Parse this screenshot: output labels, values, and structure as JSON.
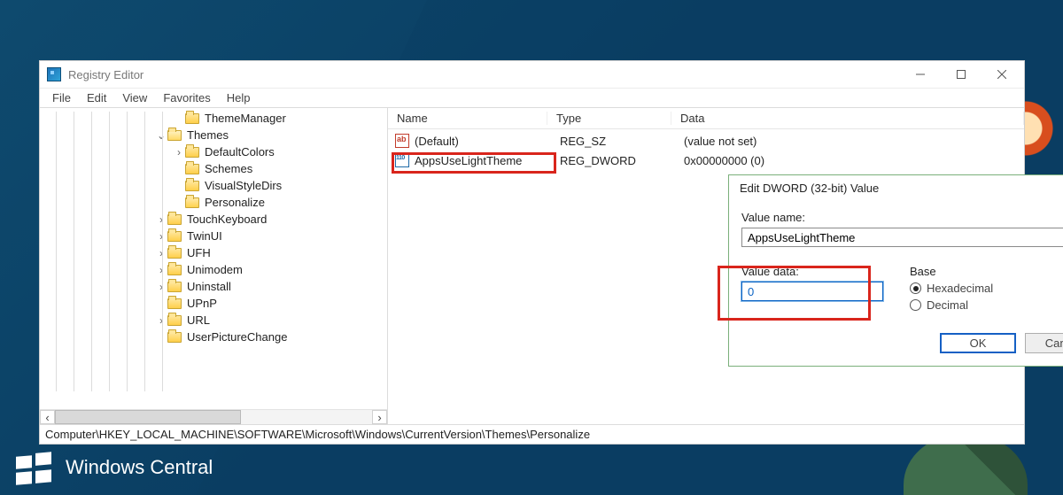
{
  "brand": {
    "name": "Windows Central"
  },
  "window": {
    "title": "Registry Editor",
    "menu": [
      "File",
      "Edit",
      "View",
      "Favorites",
      "Help"
    ],
    "status_path": "Computer\\HKEY_LOCAL_MACHINE\\SOFTWARE\\Microsoft\\Windows\\CurrentVersion\\Themes\\Personalize"
  },
  "tree": [
    {
      "indent": 8,
      "expander": "",
      "label": "ThemeManager"
    },
    {
      "indent": 7,
      "expander": "⌄",
      "label": "Themes",
      "open": true
    },
    {
      "indent": 8,
      "expander": "›",
      "label": "DefaultColors"
    },
    {
      "indent": 8,
      "expander": "",
      "label": "Schemes"
    },
    {
      "indent": 8,
      "expander": "",
      "label": "VisualStyleDirs"
    },
    {
      "indent": 8,
      "expander": "",
      "label": "Personalize",
      "selected": true
    },
    {
      "indent": 7,
      "expander": "›",
      "label": "TouchKeyboard"
    },
    {
      "indent": 7,
      "expander": "›",
      "label": "TwinUI"
    },
    {
      "indent": 7,
      "expander": "›",
      "label": "UFH"
    },
    {
      "indent": 7,
      "expander": "›",
      "label": "Unimodem"
    },
    {
      "indent": 7,
      "expander": "›",
      "label": "Uninstall"
    },
    {
      "indent": 7,
      "expander": "",
      "label": "UPnP"
    },
    {
      "indent": 7,
      "expander": "›",
      "label": "URL"
    },
    {
      "indent": 7,
      "expander": "",
      "label": "UserPictureChange"
    }
  ],
  "columns": {
    "name": "Name",
    "type": "Type",
    "data": "Data"
  },
  "values": [
    {
      "icon": "sz",
      "name": "(Default)",
      "type": "REG_SZ",
      "data": "(value not set)"
    },
    {
      "icon": "dw",
      "name": "AppsUseLightTheme",
      "type": "REG_DWORD",
      "data": "0x00000000 (0)"
    }
  ],
  "dialog": {
    "title": "Edit DWORD (32-bit) Value",
    "valuename_label": "Value name:",
    "valuename": "AppsUseLightTheme",
    "valuedata_label": "Value data:",
    "valuedata": "0",
    "base_label": "Base",
    "hex_label": "Hexadecimal",
    "dec_label": "Decimal",
    "base_selected": "hex",
    "ok": "OK",
    "cancel": "Cancel"
  }
}
